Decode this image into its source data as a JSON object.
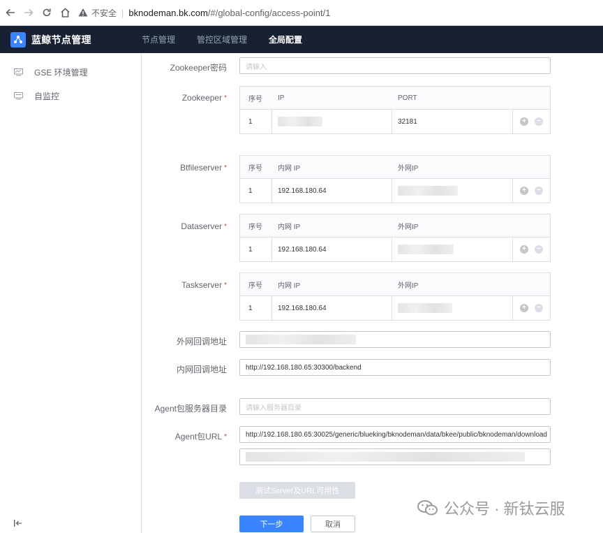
{
  "browser": {
    "insecure_label": "不安全",
    "url_host": "bknodeman.bk.com",
    "url_path": "/#/global-config/access-point/1"
  },
  "app": {
    "title": "蓝鲸节点管理",
    "nav": [
      "节点管理",
      "管控区域管理",
      "全局配置"
    ],
    "active_nav": "全局配置"
  },
  "sidebar": {
    "items": [
      {
        "label": "GSE 环境管理",
        "icon": "monitor-icon"
      },
      {
        "label": "自监控",
        "icon": "monitor-icon"
      }
    ]
  },
  "form": {
    "zk_password": {
      "label": "Zookeeper密码",
      "placeholder": "请输入"
    },
    "zookeeper": {
      "label": "Zookeeper",
      "headers": [
        "序号",
        "IP",
        "PORT"
      ],
      "rows": [
        {
          "index": "1",
          "ip": "",
          "port": "32181"
        }
      ]
    },
    "btfileserver": {
      "label": "Btfileserver",
      "headers": [
        "序号",
        "内网 IP",
        "外网IP"
      ],
      "rows": [
        {
          "index": "1",
          "inner_ip": "192.168.180.64",
          "outer_ip": ""
        }
      ]
    },
    "dataserver": {
      "label": "Dataserver",
      "headers": [
        "序号",
        "内网 IP",
        "外网IP"
      ],
      "rows": [
        {
          "index": "1",
          "inner_ip": "192.168.180.64",
          "outer_ip": ""
        }
      ]
    },
    "taskserver": {
      "label": "Taskserver",
      "headers": [
        "序号",
        "内网 IP",
        "外网IP"
      ],
      "rows": [
        {
          "index": "1",
          "inner_ip": "192.168.180.64",
          "outer_ip": ""
        }
      ]
    },
    "outer_callback": {
      "label": "外网回调地址",
      "value": ""
    },
    "inner_callback": {
      "label": "内网回调地址",
      "value": "http://192.168.180.65:30300/backend"
    },
    "agent_pkg_dir": {
      "label": "Agent包服务器目录",
      "placeholder": "请输入服务器目录"
    },
    "agent_pkg_url": {
      "label": "Agent包URL",
      "value": "http://192.168.180.65:30025/generic/blueking/bknodeman/data/bkee/public/bknodeman/download",
      "value2": ""
    },
    "plus_symbol": "+",
    "minus_symbol": "−"
  },
  "buttons": {
    "test": "测试Server及URL可用性",
    "next": "下一步",
    "cancel": "取消"
  },
  "watermark": {
    "text": "公众号 · 新钛云服"
  },
  "colors": {
    "header_bg": "#182132",
    "primary": "#3a84ff",
    "required": "#ea3636"
  }
}
